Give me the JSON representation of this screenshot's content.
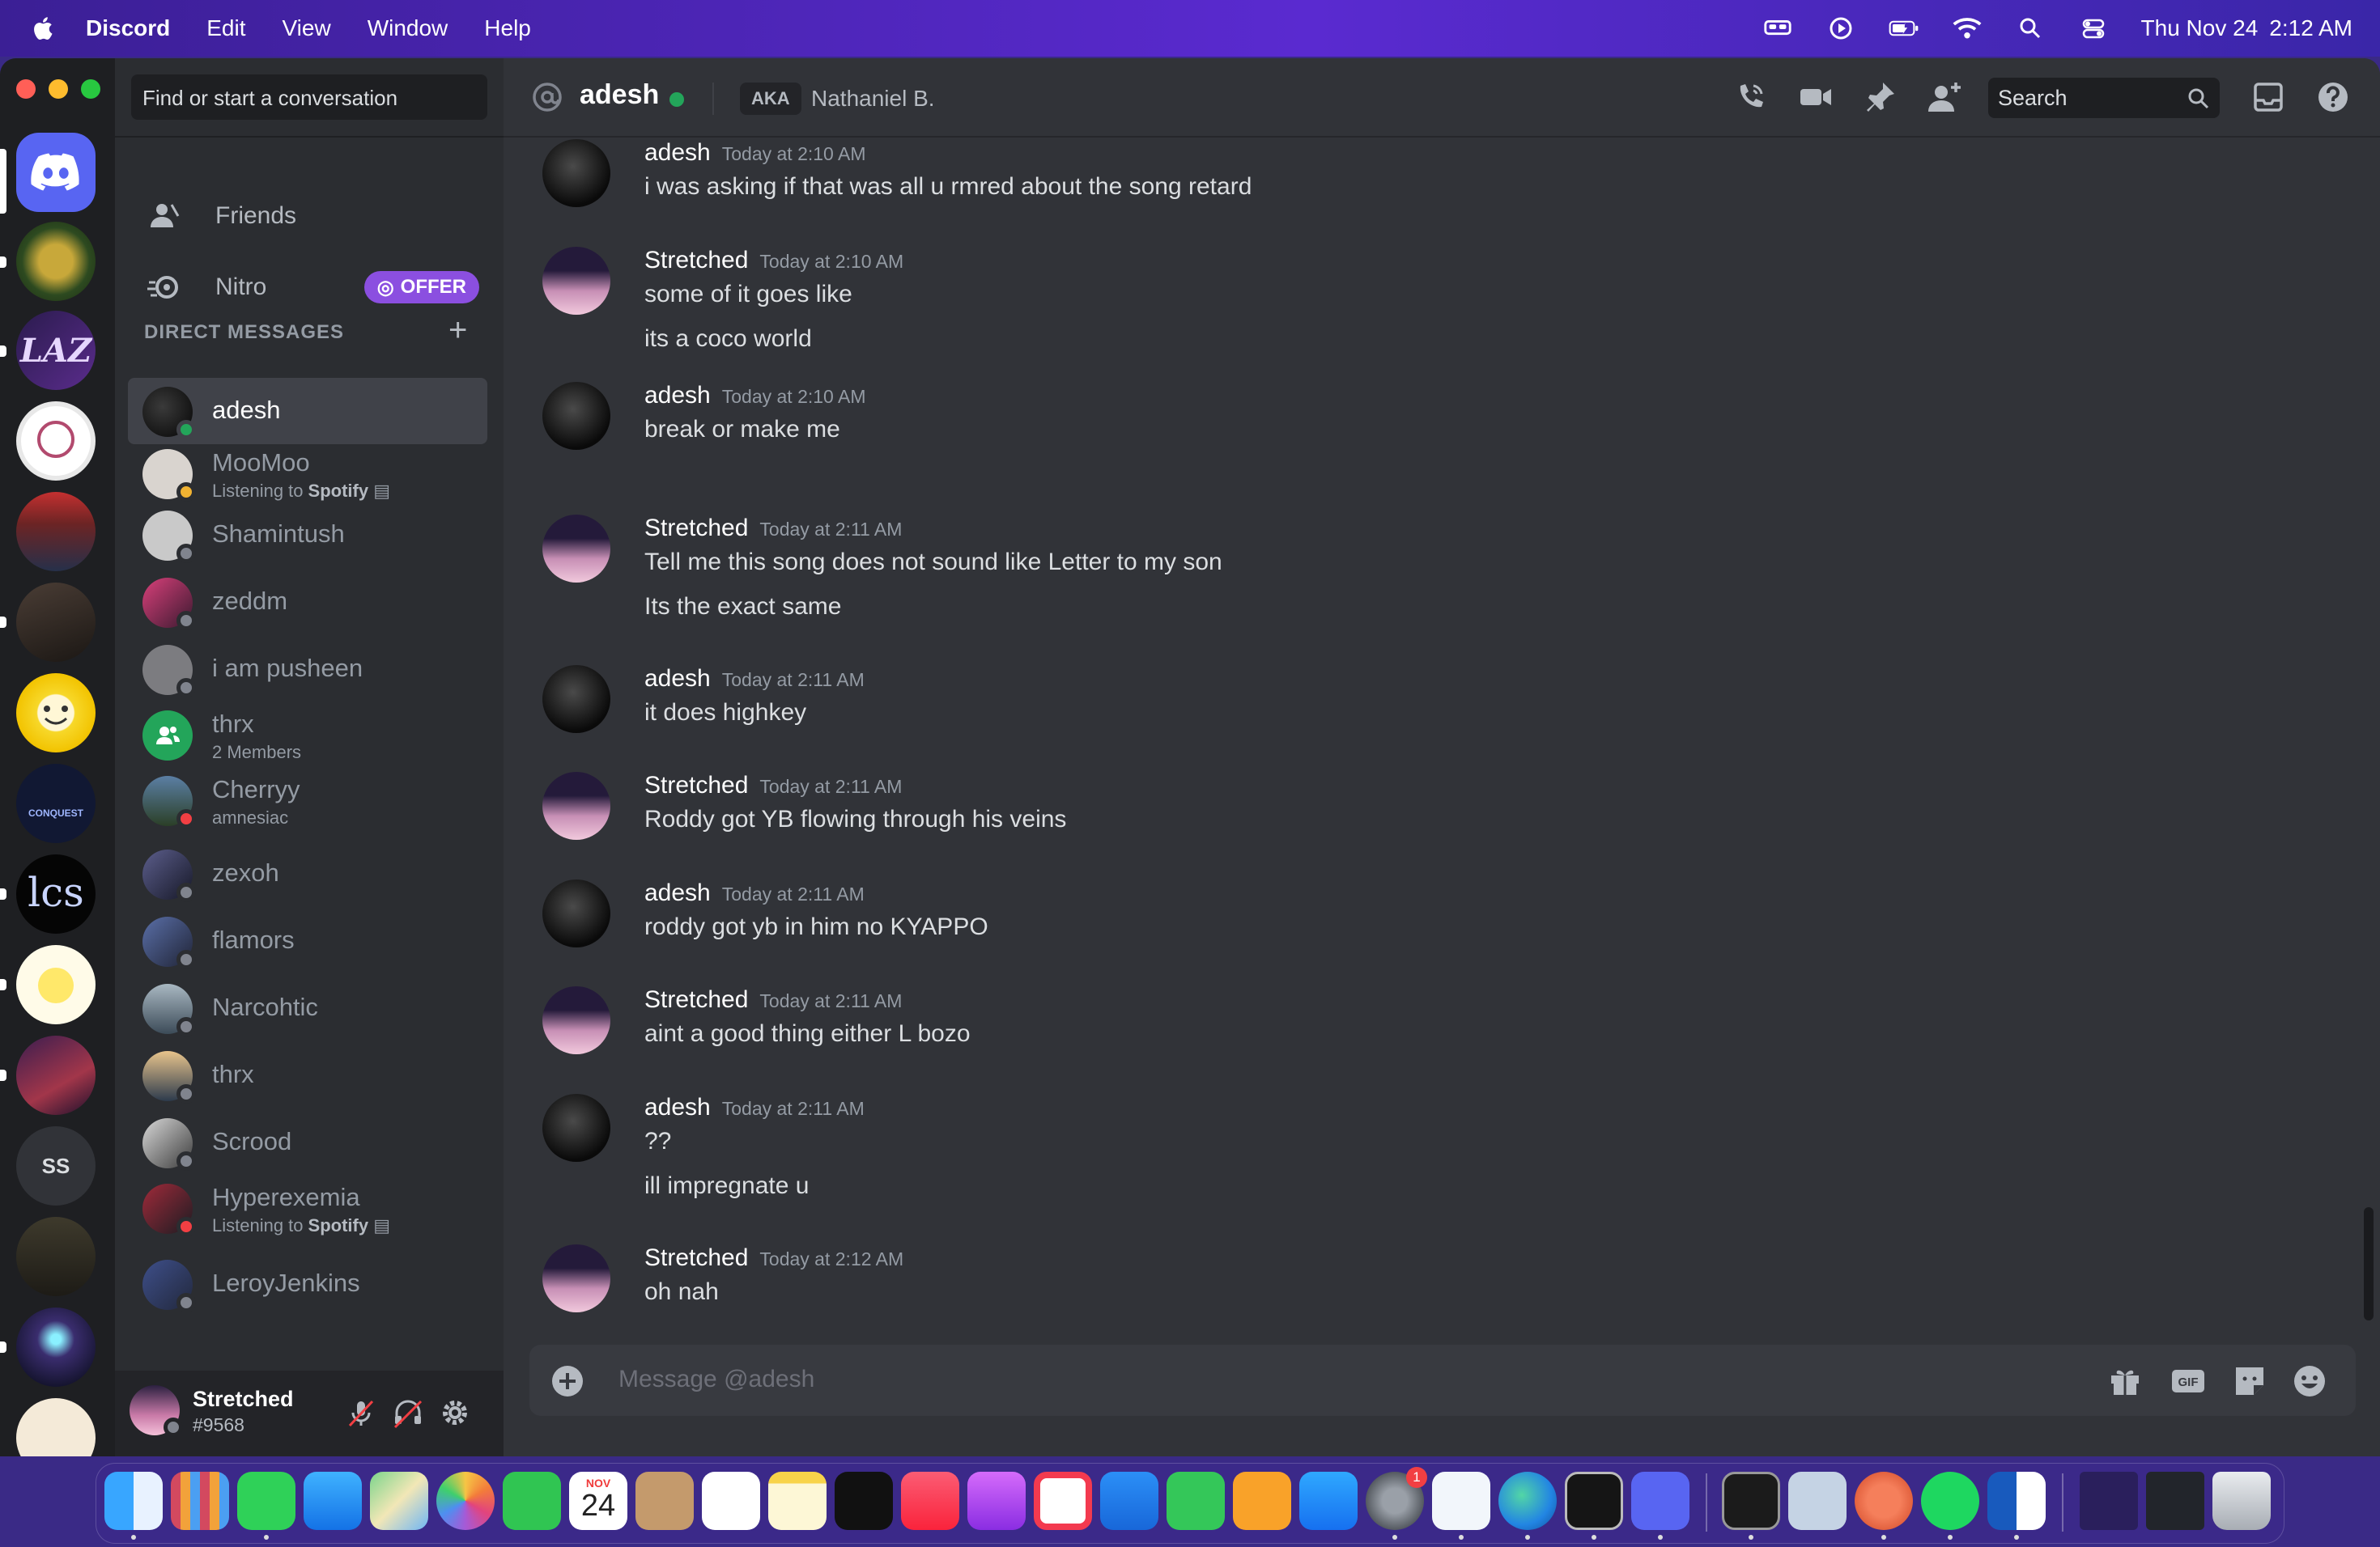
{
  "menubar": {
    "app_name": "Discord",
    "menus": [
      "Edit",
      "View",
      "Window",
      "Help"
    ],
    "date": "Thu Nov 24",
    "time": "2:12 AM"
  },
  "sidebar": {
    "search_placeholder": "Find or start a conversation",
    "nav": [
      {
        "label": "Friends",
        "icon": "friends-icon"
      },
      {
        "label": "Nitro",
        "icon": "nitro-icon",
        "badge": "OFFER"
      }
    ],
    "dm_header": "DIRECT MESSAGES",
    "dms": [
      {
        "name": "adesh",
        "status": "online",
        "active": true
      },
      {
        "name": "MooMoo",
        "status": "idle",
        "sub_prefix": "Listening to",
        "sub_bold": "Spotify"
      },
      {
        "name": "Shamintush",
        "status": "offline"
      },
      {
        "name": "zeddm",
        "status": "offline"
      },
      {
        "name": "i am pusheen",
        "status": "offline"
      },
      {
        "name": "thrx",
        "group": true,
        "sub_prefix": "2 Members"
      },
      {
        "name": "Cherryy",
        "status": "dnd",
        "sub_prefix": "amnesiac"
      },
      {
        "name": "zexoh",
        "status": "offline"
      },
      {
        "name": "flamors",
        "status": "offline"
      },
      {
        "name": "Narcohtic",
        "status": "offline"
      },
      {
        "name": "thrx",
        "status": "offline"
      },
      {
        "name": "Scrood",
        "status": "offline"
      },
      {
        "name": "Hyperexemia",
        "status": "dnd",
        "sub_prefix": "Listening to",
        "sub_bold": "Spotify"
      },
      {
        "name": "LeroyJenkins",
        "status": "offline"
      }
    ],
    "user": {
      "name": "Stretched",
      "tag": "#9568"
    }
  },
  "servers": {
    "initials_item": "SS"
  },
  "channel": {
    "name": "adesh",
    "aka_label": "AKA",
    "aka_name": "Nathaniel B.",
    "search_placeholder": "Search"
  },
  "messages": [
    {
      "author": "adesh",
      "time": "Today at 2:10 AM",
      "lines": [
        "i was asking if that was all u rmred about the song retard"
      ]
    },
    {
      "author": "Stretched",
      "time": "Today at 2:10 AM",
      "lines": [
        "some of it goes like",
        "its a coco world"
      ]
    },
    {
      "author": "adesh",
      "time": "Today at 2:10 AM",
      "lines": [
        "break or make me"
      ]
    },
    {
      "author": "Stretched",
      "time": "Today at 2:11 AM",
      "lines": [
        "Tell me this song does not sound like Letter to my son",
        "Its the exact same"
      ]
    },
    {
      "author": "adesh",
      "time": "Today at 2:11 AM",
      "lines": [
        "it does highkey"
      ]
    },
    {
      "author": "Stretched",
      "time": "Today at 2:11 AM",
      "lines": [
        "Roddy got YB flowing through his veins"
      ]
    },
    {
      "author": "adesh",
      "time": "Today at 2:11 AM",
      "lines": [
        "roddy got yb in him no KYAPPO"
      ]
    },
    {
      "author": "Stretched",
      "time": "Today at 2:11 AM",
      "lines": [
        "aint a good thing either L bozo"
      ]
    },
    {
      "author": "adesh",
      "time": "Today at 2:11 AM",
      "lines": [
        "??",
        "ill impregnate u"
      ]
    },
    {
      "author": "Stretched",
      "time": "Today at 2:12 AM",
      "lines": [
        "oh nah"
      ]
    }
  ],
  "composer": {
    "placeholder": "Message @adesh"
  },
  "dock": {
    "calendar_month": "NOV",
    "calendar_day": "24",
    "settings_badge": "1"
  },
  "colors": {
    "accent": "#5865f2",
    "online": "#23a55a",
    "idle": "#f0b232",
    "dnd": "#f23f43",
    "offline": "#80848e"
  }
}
